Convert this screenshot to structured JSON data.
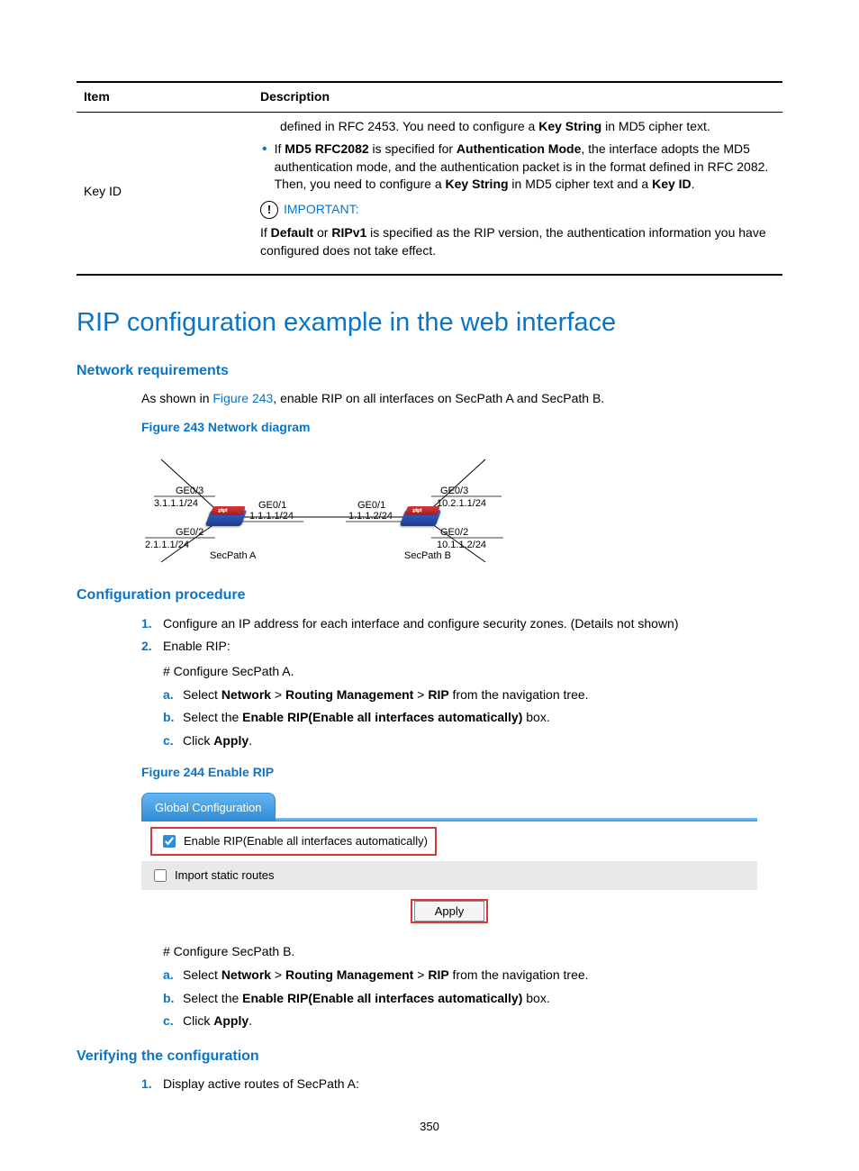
{
  "table": {
    "headers": {
      "item": "Item",
      "description": "Description"
    },
    "row": {
      "item": "Key ID",
      "para1_pre": "defined in RFC 2453. You need to configure a ",
      "para1_bold": "Key String",
      "para1_post": " in MD5 cipher text.",
      "bullet_pre": "If ",
      "bullet_b1": "MD5 RFC2082",
      "bullet_mid1": " is specified for ",
      "bullet_b2": "Authentication Mode",
      "bullet_mid2": ", the interface adopts the MD5 authentication mode, and the authentication packet is in the format defined in RFC 2082. Then, you need to configure a ",
      "bullet_b3": "Key String",
      "bullet_mid3": " in MD5 cipher text and a ",
      "bullet_b4": "Key ID",
      "bullet_post": ".",
      "important_label": "IMPORTANT:",
      "note_pre": "If ",
      "note_b1": "Default",
      "note_mid1": " or ",
      "note_b2": "RIPv1",
      "note_post": " is specified as the RIP version, the authentication information you have configured does not take effect."
    }
  },
  "heading": "RIP configuration example in the web interface",
  "net_req": {
    "title": "Network requirements",
    "text_pre": "As shown in ",
    "text_link": "Figure 243",
    "text_post": ", enable RIP on all interfaces on SecPath A and SecPath B.",
    "caption": "Figure 243 Network diagram"
  },
  "diagram": {
    "ge03_a": "GE0/3",
    "ip03_a": "3.1.1.1/24",
    "ge02_a": "GE0/2",
    "ip02_a": "2.1.1.1/24",
    "ge01_a": "GE0/1",
    "ip01_a": "1.1.1.1/24",
    "name_a": "SecPath A",
    "ge03_b": "GE0/3",
    "ip03_b": "10.2.1.1/24",
    "ge02_b": "GE0/2",
    "ip02_b": "10.1.1.2/24",
    "ge01_b": "GE0/1",
    "ip01_b": "1.1.1.2/24",
    "name_b": "SecPath B"
  },
  "config": {
    "title": "Configuration procedure",
    "step1": "Configure an IP address for each interface and configure security zones. (Details not shown)",
    "step2": "Enable RIP:",
    "hash_a": "# Configure SecPath A.",
    "hash_b": "# Configure SecPath B.",
    "sub_a_pre": "Select ",
    "sub_a_b1": "Network",
    "sub_a_gt1": " > ",
    "sub_a_b2": "Routing Management",
    "sub_a_gt2": " > ",
    "sub_a_b3": "RIP",
    "sub_a_post": " from the navigation tree.",
    "sub_b_pre": "Select the ",
    "sub_b_b1": "Enable RIP(Enable all interfaces automatically)",
    "sub_b_post": " box.",
    "sub_c_pre": "Click ",
    "sub_c_b1": "Apply",
    "sub_c_post": ".",
    "caption2": "Figure 244 Enable RIP"
  },
  "rip_shot": {
    "tab": "Global Configuration",
    "row1": "Enable RIP(Enable all interfaces automatically)",
    "row2": "Import static routes",
    "apply": "Apply"
  },
  "verify": {
    "title": "Verifying the configuration",
    "step1": "Display active routes of SecPath A:"
  },
  "markers": {
    "n1": "1.",
    "n2": "2.",
    "la": "a.",
    "lb": "b.",
    "lc": "c."
  },
  "page_number": "350"
}
